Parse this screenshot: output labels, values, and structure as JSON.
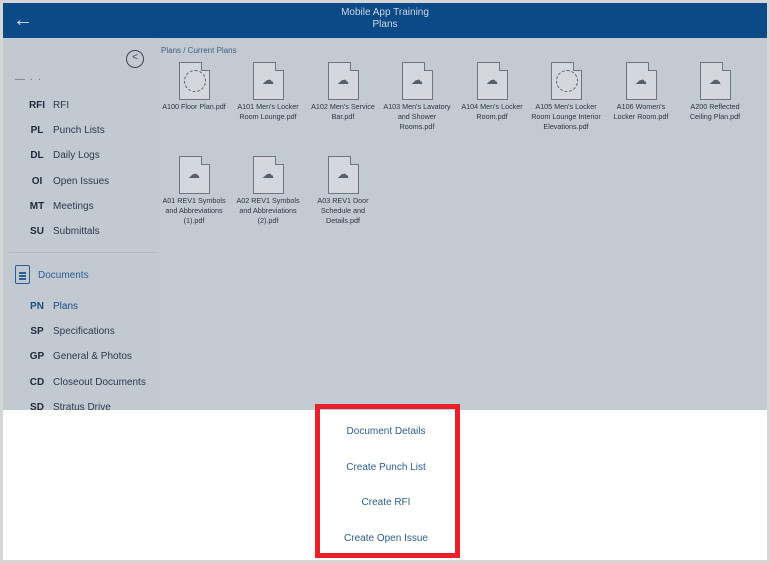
{
  "header": {
    "back_icon": "arrow-left-icon",
    "project": "Mobile App Training",
    "title": "Plans"
  },
  "sidebar": {
    "collapse_icon": "chevron-left-circle-icon",
    "cutoff_text": "— · ·",
    "items": [
      {
        "abbr": "RFI",
        "label": "RFI"
      },
      {
        "abbr": "PL",
        "label": "Punch Lists"
      },
      {
        "abbr": "DL",
        "label": "Daily Logs"
      },
      {
        "abbr": "OI",
        "label": "Open Issues"
      },
      {
        "abbr": "MT",
        "label": "Meetings"
      },
      {
        "abbr": "SU",
        "label": "Submittals"
      }
    ],
    "documents": {
      "icon": "document-icon",
      "label": "Documents"
    },
    "doc_items": [
      {
        "abbr": "PN",
        "label": "Plans"
      },
      {
        "abbr": "SP",
        "label": "Specifications"
      },
      {
        "abbr": "GP",
        "label": "General & Photos"
      },
      {
        "abbr": "CD",
        "label": "Closeout Documents"
      },
      {
        "abbr": "SD",
        "label": "Stratus Drive"
      }
    ]
  },
  "main": {
    "breadcrumb": "Plans  / Current Plans",
    "files": [
      {
        "name": "A100 Floor Plan.pdf",
        "icon": "loading-icon"
      },
      {
        "name": "A101 Men's Locker Room Lounge.pdf",
        "icon": "cloud-download-icon"
      },
      {
        "name": "A102 Men's Service Bar.pdf",
        "icon": "cloud-download-icon"
      },
      {
        "name": "A103 Men's Lavatory and Shower Rooms.pdf",
        "icon": "cloud-download-icon"
      },
      {
        "name": "A104 Men's Locker Room.pdf",
        "icon": "cloud-download-icon"
      },
      {
        "name": "A105 Men's Locker Room Lounge Interior Elevations.pdf",
        "icon": "loading-icon"
      },
      {
        "name": "A106 Women's Locker Room.pdf",
        "icon": "cloud-download-icon"
      },
      {
        "name": "A200 Reflected Ceiling Plan.pdf",
        "icon": "cloud-download-icon"
      },
      {
        "name": "A01 REV1 Symbols and Abbreviations (1).pdf",
        "icon": "cloud-download-icon"
      },
      {
        "name": "A02 REV1 Symbols and Abbreviations (2).pdf",
        "icon": "cloud-download-icon"
      },
      {
        "name": "A03 REV1 Door Schedule and Details.pdf",
        "icon": "cloud-download-icon"
      }
    ]
  },
  "action_sheet": {
    "actions": [
      "Document Details",
      "Create Punch List",
      "Create RFI",
      "Create Open Issue"
    ]
  },
  "colors": {
    "header": "#0b4a86",
    "highlight": "#e8202a",
    "link": "#2f5c89"
  }
}
